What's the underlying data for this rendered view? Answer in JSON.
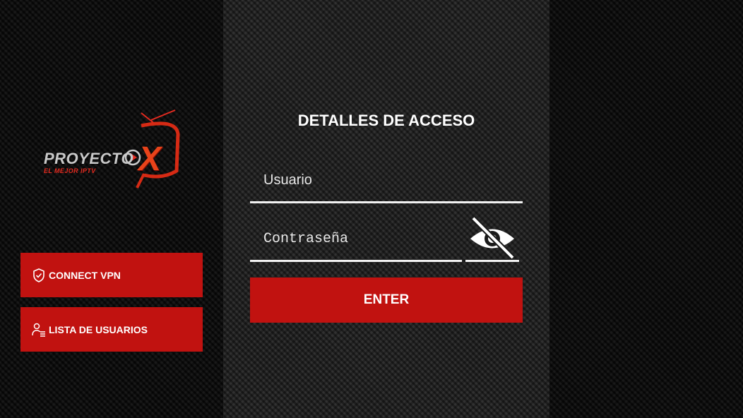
{
  "logo": {
    "brand_text": "PROYECTO",
    "brand_x": "X",
    "tagline": "EL MEJOR IPTV"
  },
  "sidebar": {
    "connect_vpn": {
      "label": "CONNECT VPN",
      "icon": "shield-check-icon"
    },
    "user_list": {
      "label": "LISTA DE USUARIOS",
      "icon": "user-list-icon"
    }
  },
  "login": {
    "title": "DETALLES DE ACCESO",
    "username": {
      "value": "",
      "placeholder": "Usuario"
    },
    "password": {
      "value": "",
      "placeholder": "Contraseña"
    },
    "visibility_icon": "eye-off-icon",
    "enter_label": "ENTER"
  },
  "colors": {
    "accent_red": "#c11210",
    "logo_orange": "#e8431a",
    "text_white": "#ffffff",
    "background": "#141414"
  }
}
